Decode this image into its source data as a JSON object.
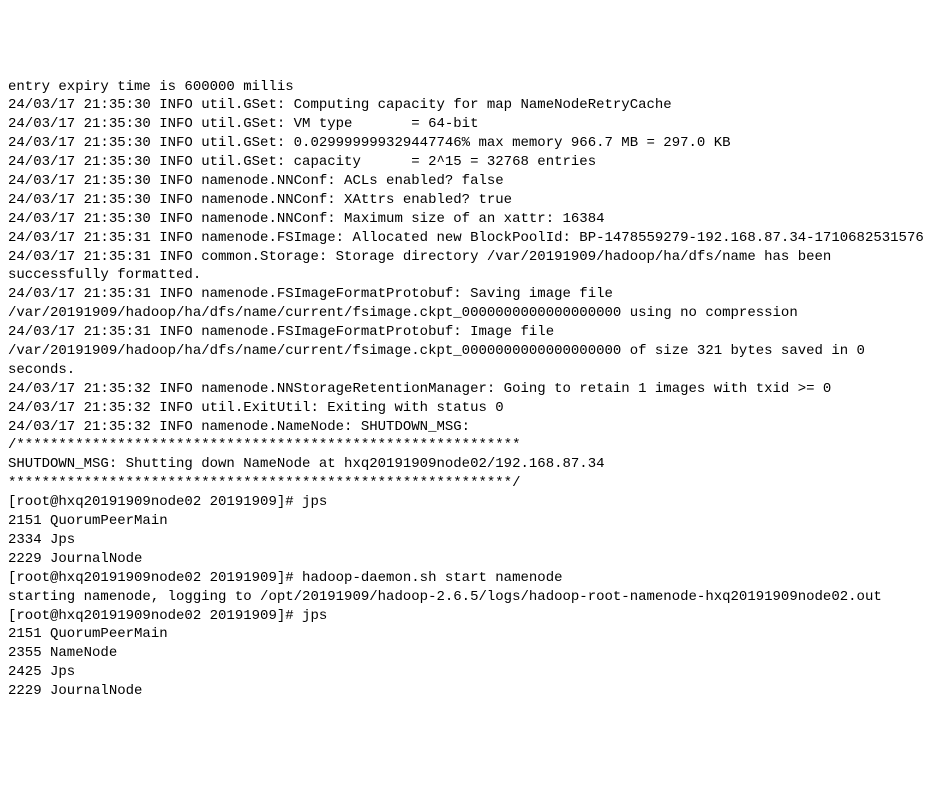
{
  "terminal": {
    "lines": [
      "entry expiry time is 600000 millis",
      "24/03/17 21:35:30 INFO util.GSet: Computing capacity for map NameNodeRetryCache",
      "24/03/17 21:35:30 INFO util.GSet: VM type       = 64-bit",
      "24/03/17 21:35:30 INFO util.GSet: 0.029999999329447746% max memory 966.7 MB = 297.0 KB",
      "24/03/17 21:35:30 INFO util.GSet: capacity      = 2^15 = 32768 entries",
      "24/03/17 21:35:30 INFO namenode.NNConf: ACLs enabled? false",
      "24/03/17 21:35:30 INFO namenode.NNConf: XAttrs enabled? true",
      "24/03/17 21:35:30 INFO namenode.NNConf: Maximum size of an xattr: 16384",
      "24/03/17 21:35:31 INFO namenode.FSImage: Allocated new BlockPoolId: BP-1478559279-192.168.87.34-1710682531576",
      "24/03/17 21:35:31 INFO common.Storage: Storage directory /var/20191909/hadoop/ha/dfs/name has been successfully formatted.",
      "24/03/17 21:35:31 INFO namenode.FSImageFormatProtobuf: Saving image file /var/20191909/hadoop/ha/dfs/name/current/fsimage.ckpt_0000000000000000000 using no compression",
      "24/03/17 21:35:31 INFO namenode.FSImageFormatProtobuf: Image file /var/20191909/hadoop/ha/dfs/name/current/fsimage.ckpt_0000000000000000000 of size 321 bytes saved in 0 seconds.",
      "24/03/17 21:35:32 INFO namenode.NNStorageRetentionManager: Going to retain 1 images with txid >= 0",
      "24/03/17 21:35:32 INFO util.ExitUtil: Exiting with status 0",
      "24/03/17 21:35:32 INFO namenode.NameNode: SHUTDOWN_MSG:",
      "/************************************************************",
      "SHUTDOWN_MSG: Shutting down NameNode at hxq20191909node02/192.168.87.34",
      "************************************************************/",
      "[root@hxq20191909node02 20191909]# jps",
      "2151 QuorumPeerMain",
      "2334 Jps",
      "2229 JournalNode",
      "[root@hxq20191909node02 20191909]# hadoop-daemon.sh start namenode",
      "starting namenode, logging to /opt/20191909/hadoop-2.6.5/logs/hadoop-root-namenode-hxq20191909node02.out",
      "[root@hxq20191909node02 20191909]# jps",
      "2151 QuorumPeerMain",
      "2355 NameNode",
      "2425 Jps",
      "2229 JournalNode"
    ]
  }
}
